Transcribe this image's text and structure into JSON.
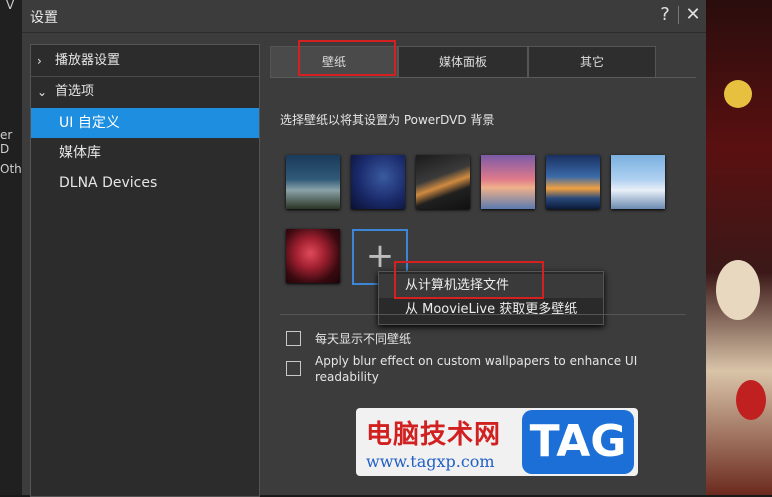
{
  "background_app": {
    "left_fragments": [
      "V",
      "er D",
      "Oth"
    ]
  },
  "dialog": {
    "title": "设置",
    "help_button": "?",
    "close_button": "✕"
  },
  "sidebar": {
    "items": [
      {
        "label": "播放器设置",
        "chevron": "›"
      },
      {
        "label": "首选项",
        "chevron": "⌄"
      },
      {
        "label": "UI 自定义",
        "selected": true
      },
      {
        "label": "媒体库"
      },
      {
        "label": "DLNA Devices"
      }
    ]
  },
  "tabs": [
    {
      "label": "壁纸",
      "active": true
    },
    {
      "label": "媒体面板"
    },
    {
      "label": "其它"
    }
  ],
  "wallpaper": {
    "description": "选择壁纸以将其设置为 PowerDVD 背景",
    "thumbnails": [
      "starry-lake",
      "night-sky",
      "bridge-night",
      "pink-sunset",
      "sea-sunset",
      "snow-mountain",
      "red-flower"
    ],
    "add_button": "+"
  },
  "context_menu": {
    "items": [
      {
        "label": "从计算机选择文件"
      },
      {
        "label": "从 MoovieLive 获取更多壁纸"
      }
    ]
  },
  "options": {
    "daily_wallpaper": {
      "label": "每天显示不同壁纸",
      "checked": false
    },
    "blur_effect": {
      "label_line1": "Apply blur effect on custom wallpapers to enhance UI",
      "label_line2": "readability",
      "checked": false
    }
  },
  "watermark": {
    "cn": "电脑技术网",
    "url": "www.tagxp.com",
    "tag": "TAG"
  },
  "colors": {
    "accent": "#1e8fe0",
    "highlight": "#d42020"
  }
}
